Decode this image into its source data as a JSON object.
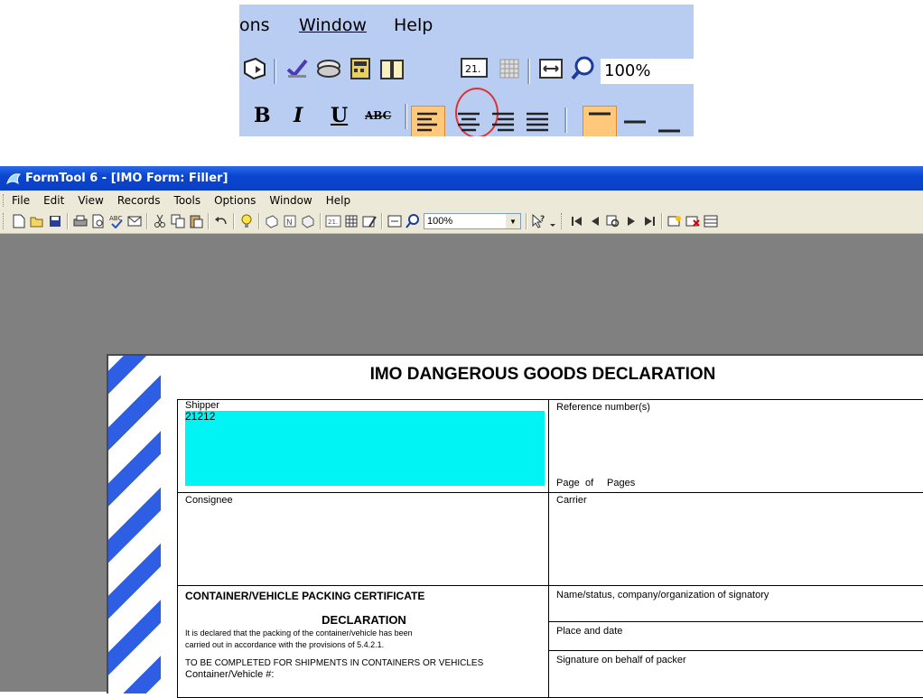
{
  "zoom_inset": {
    "menu": [
      "ons",
      "Window",
      "Help"
    ],
    "zoom_level": "100%",
    "format_labels": [
      "B",
      "I",
      "U",
      "ABC"
    ]
  },
  "window": {
    "title": "FormTool 6 - [IMO Form: Filler]",
    "menu": [
      "File",
      "Edit",
      "View",
      "Records",
      "Tools",
      "Options",
      "Window",
      "Help"
    ],
    "zoom_level": "100%"
  },
  "form": {
    "title": "IMO DANGEROUS GOODS DECLARATION",
    "shipper_label": "Shipper",
    "shipper_value": "21212",
    "reference_label": "Reference number(s)",
    "page_label": "Page",
    "of_label": "of",
    "pages_label": "Pages",
    "consignee_label": "Consignee",
    "carrier_label": "Carrier",
    "cert_heading": "CONTAINER/VEHICLE PACKING CERTIFICATE",
    "declaration_heading": "DECLARATION",
    "declaration_text_1": "It is declared that the packing of the container/vehicle has been",
    "declaration_text_2": "carried out in accordance with the provisions of 5.4.2.1.",
    "containers_text": "TO BE COMPLETED FOR SHIPMENTS IN CONTAINERS OR VEHICLES",
    "container_no_label": "Container/Vehicle #:",
    "signatory_label": "Name/status, company/organization of signatory",
    "place_date_label": "Place and date",
    "signature_label": "Signature on behalf of packer"
  }
}
